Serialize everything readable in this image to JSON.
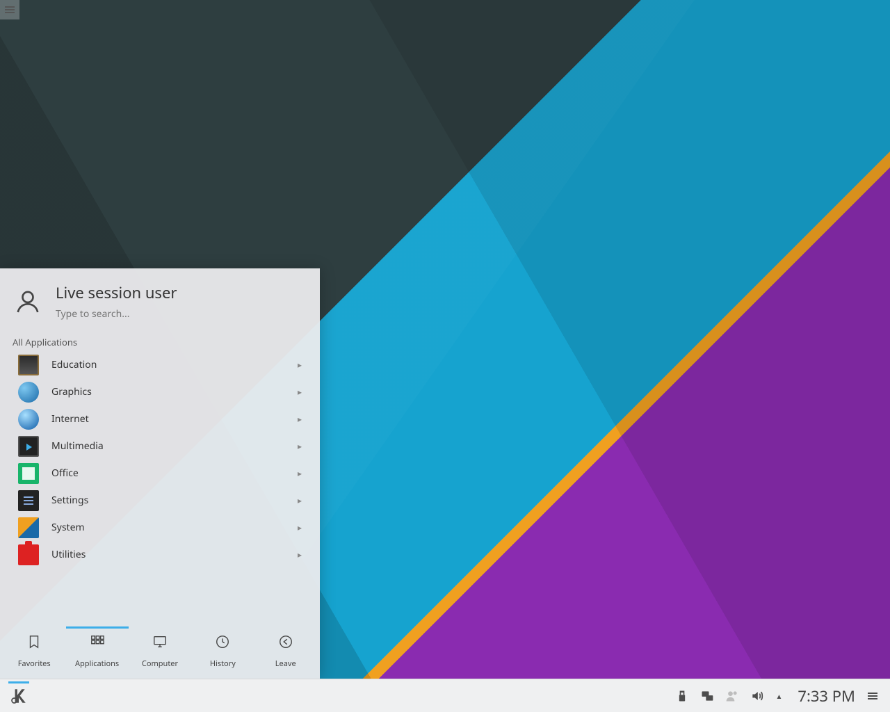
{
  "launcher": {
    "user_name": "Live session user",
    "search_placeholder": "Type to search...",
    "section_label": "All Applications",
    "categories": [
      {
        "label": "Education",
        "icon": "education-icon"
      },
      {
        "label": "Graphics",
        "icon": "graphics-icon"
      },
      {
        "label": "Internet",
        "icon": "internet-icon"
      },
      {
        "label": "Multimedia",
        "icon": "multimedia-icon"
      },
      {
        "label": "Office",
        "icon": "office-icon"
      },
      {
        "label": "Settings",
        "icon": "settings-icon"
      },
      {
        "label": "System",
        "icon": "system-icon"
      },
      {
        "label": "Utilities",
        "icon": "utilities-icon"
      }
    ],
    "tabs": [
      {
        "label": "Favorites",
        "icon": "bookmark-icon",
        "active": false
      },
      {
        "label": "Applications",
        "icon": "grid-icon",
        "active": true
      },
      {
        "label": "Computer",
        "icon": "monitor-icon",
        "active": false
      },
      {
        "label": "History",
        "icon": "clock-icon",
        "active": false
      },
      {
        "label": "Leave",
        "icon": "leave-icon",
        "active": false
      }
    ]
  },
  "taskbar": {
    "clock": "7:33 PM",
    "tray_icons": [
      {
        "name": "usb-icon",
        "dim": false
      },
      {
        "name": "network-icon",
        "dim": false
      },
      {
        "name": "user-icon",
        "dim": true
      },
      {
        "name": "volume-icon",
        "dim": false
      }
    ]
  }
}
